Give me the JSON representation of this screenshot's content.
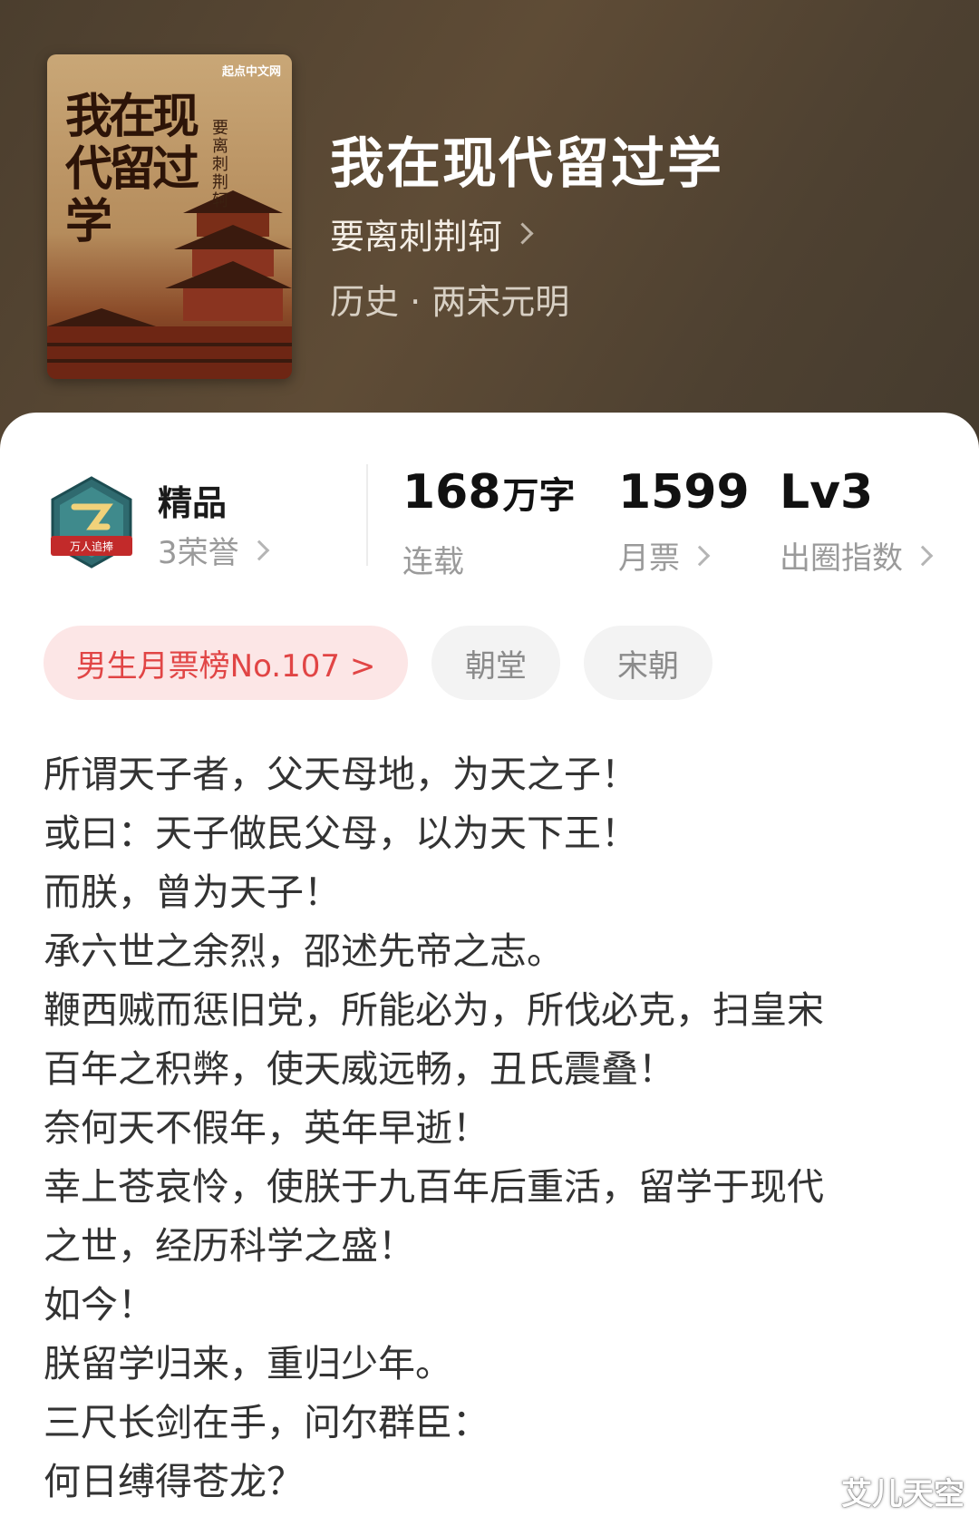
{
  "book": {
    "title": "我在现代留过学",
    "author": "要离刺荆轲",
    "category": "历史 · 两宋元明",
    "cover": {
      "brand": "起点中文网",
      "title": "我在现代留过学",
      "author": "要离刺荆轲"
    }
  },
  "honor": {
    "badge_text": "万人追捧",
    "grade": "精品",
    "honors": "3荣誉"
  },
  "stats": [
    {
      "value": "168",
      "unit": "万字",
      "label": "连载",
      "has_chevron": false
    },
    {
      "value": "1599",
      "unit": "",
      "label": "月票",
      "has_chevron": true
    },
    {
      "value": "Lv3",
      "unit": "",
      "label": "出圈指数",
      "has_chevron": true
    }
  ],
  "chips": {
    "rank": "男生月票榜No.107 >",
    "tags": [
      "朝堂",
      "宋朝"
    ]
  },
  "synopsis": [
    "所谓天子者，父天母地，为天之子！",
    "或曰：天子做民父母，以为天下王！",
    "而朕，曾为天子！",
    "承六世之余烈，邵述先帝之志。",
    "鞭西贼而惩旧党，所能必为，所伐必克，扫皇宋",
    "百年之积弊，使天威远畅，丑氏震叠！",
    "奈何天不假年，英年早逝！",
    "幸上苍哀怜，使朕于九百年后重活，留学于现代",
    "之世，经历科学之盛！",
    "如今！",
    "朕留学归来，重归少年。",
    "三尺长剑在手，问尔群臣：",
    "何日缚得苍龙？"
  ],
  "watermark": "艾儿天空",
  "colors": {
    "header_bg": "#54442f",
    "rank_chip_bg": "#fce6e6",
    "rank_chip_text": "#e14545",
    "tag_chip_bg": "#f3f3f3"
  }
}
